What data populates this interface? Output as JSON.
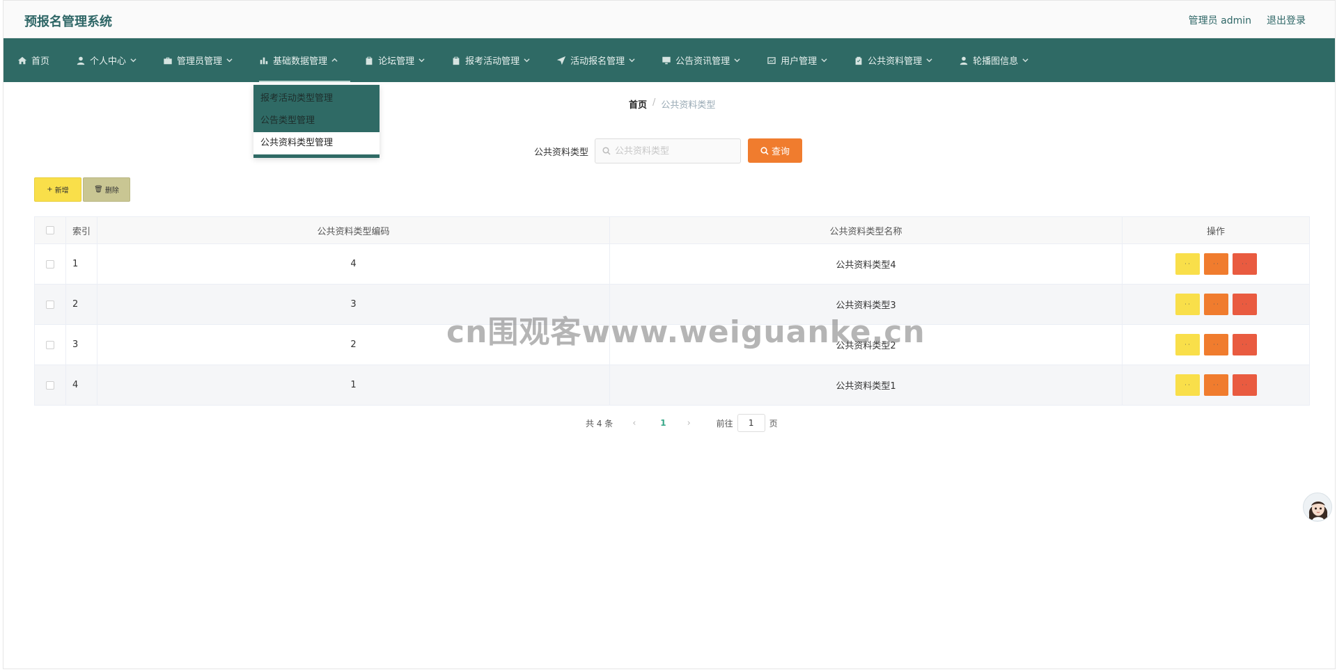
{
  "header": {
    "app_title": "预报名管理系统",
    "user_label": "管理员 admin",
    "logout_label": "退出登录"
  },
  "nav": {
    "items": [
      {
        "label": "首页",
        "icon": "home-icon",
        "has_dropdown": false
      },
      {
        "label": "个人中心",
        "icon": "person-icon",
        "has_dropdown": true
      },
      {
        "label": "管理员管理",
        "icon": "briefcase-icon",
        "has_dropdown": true
      },
      {
        "label": "基础数据管理",
        "icon": "bar-chart-icon",
        "has_dropdown": true
      },
      {
        "label": "论坛管理",
        "icon": "clipboard-icon",
        "has_dropdown": true
      },
      {
        "label": "报考活动管理",
        "icon": "clipboard-icon",
        "has_dropdown": true
      },
      {
        "label": "活动报名管理",
        "icon": "send-icon",
        "has_dropdown": true
      },
      {
        "label": "公告资讯管理",
        "icon": "monitor-icon",
        "has_dropdown": true
      },
      {
        "label": "用户管理",
        "icon": "chart-window-icon",
        "has_dropdown": true
      },
      {
        "label": "公共资料管理",
        "icon": "clipboard-check-icon",
        "has_dropdown": true
      },
      {
        "label": "轮播图信息",
        "icon": "user-icon",
        "has_dropdown": true
      }
    ],
    "active_index": 3
  },
  "dropdown": {
    "items": [
      "报考活动类型管理",
      "公告类型管理",
      "公共资料类型管理"
    ],
    "selected_index": 2
  },
  "breadcrumb": {
    "home": "首页",
    "separator": "/",
    "current": "公共资料类型"
  },
  "search": {
    "label": "公共资料类型",
    "placeholder": "公共资料类型",
    "value": "",
    "button_label": "查询"
  },
  "actions": {
    "add_label": "新增",
    "delete_label": "删除"
  },
  "table": {
    "headers": {
      "index": "索引",
      "code": "公共资料类型编码",
      "name": "公共资料类型名称",
      "ops": "操作"
    },
    "rows": [
      {
        "index": "1",
        "code": "4",
        "name": "公共资料类型4"
      },
      {
        "index": "2",
        "code": "3",
        "name": "公共资料类型3"
      },
      {
        "index": "3",
        "code": "2",
        "name": "公共资料类型2"
      },
      {
        "index": "4",
        "code": "1",
        "name": "公共资料类型1"
      }
    ],
    "op_colors": {
      "view": "#f9df4a",
      "edit": "#f07c2e",
      "delete": "#e95b40"
    }
  },
  "pagination": {
    "total_text": "共 4 条",
    "current_page": "1",
    "goto_prefix": "前往",
    "goto_value": "1",
    "goto_suffix": "页"
  },
  "watermark": "cn围观客www.weiguanke.cn",
  "colors": {
    "nav_bg": "#2f6a65",
    "title": "#2e6666",
    "accent_orange": "#f07c2e",
    "accent_yellow": "#f9df4a",
    "delete_olive": "#c9c693",
    "page_active": "#3aa98a"
  }
}
